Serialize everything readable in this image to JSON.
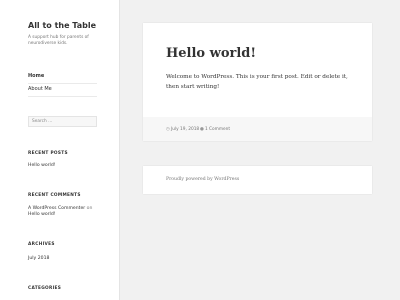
{
  "site": {
    "title": "All to the Table",
    "description": "A support hub for parents of neurodiverse kids."
  },
  "nav": [
    {
      "label": "Home",
      "current": true
    },
    {
      "label": "About Me",
      "current": false
    }
  ],
  "search": {
    "placeholder": "Search …"
  },
  "widgets": {
    "recent_posts": {
      "title": "RECENT POSTS",
      "items": [
        "Hello world!"
      ]
    },
    "recent_comments": {
      "title": "RECENT COMMENTS",
      "author": "A WordPress Commenter",
      "connector": "on",
      "post": "Hello world!"
    },
    "archives": {
      "title": "ARCHIVES",
      "items": [
        "July 2018"
      ]
    },
    "categories": {
      "title": "CATEGORIES"
    }
  },
  "post": {
    "title": "Hello world!",
    "body": "Welcome to WordPress. This is your first post. Edit or delete it, then start writing!",
    "date": "July 19, 2018",
    "comments": "1 Comment"
  },
  "footer": {
    "credit": "Proudly powered by WordPress"
  }
}
